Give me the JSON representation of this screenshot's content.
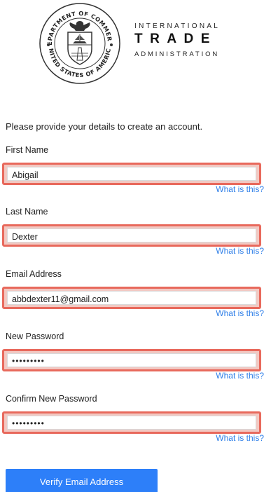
{
  "header": {
    "seal_text_top": "DEPARTMENT OF COMMERCE",
    "seal_text_bottom": "UNITED STATES OF AMERICA",
    "brand_line1": "INTERNATIONAL",
    "brand_line2": "TRADE",
    "brand_line3": "ADMINISTRATION"
  },
  "form": {
    "intro": "Please provide your details to create an account.",
    "help_label": "What is this?",
    "fields": [
      {
        "label": "First Name",
        "value": "Abigail"
      },
      {
        "label": "Last Name",
        "value": "Dexter"
      },
      {
        "label": "Email Address",
        "value": "abbdexter11@gmail.com"
      },
      {
        "label": "New Password",
        "value": "•••••••••"
      },
      {
        "label": "Confirm New Password",
        "value": "•••••••••"
      }
    ],
    "submit_label": "Verify Email Address"
  },
  "colors": {
    "highlight": "#e8695c",
    "link": "#2f7fe8",
    "button": "#2d7ff9"
  }
}
